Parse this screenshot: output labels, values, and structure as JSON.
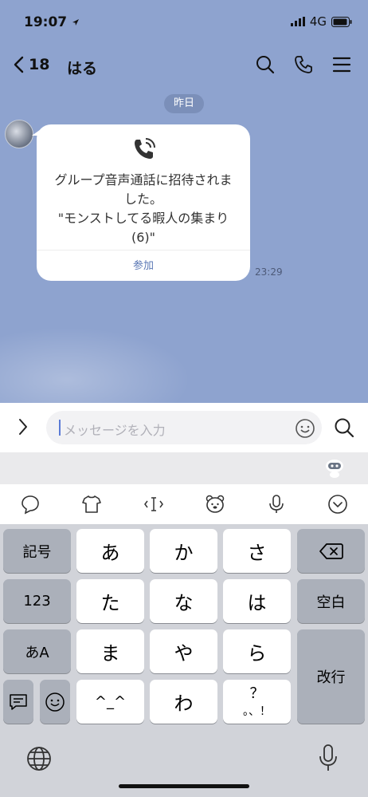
{
  "status": {
    "time": "19:07",
    "network": "4G"
  },
  "header": {
    "back_count": "18",
    "chat_name": "はる"
  },
  "date_label": "昨日",
  "message": {
    "lines": [
      "グループ音声通話に招待されま",
      "した。",
      "\"モンストしてる暇人の集まり",
      "(6)\""
    ],
    "join_label": "参加",
    "time": "23:29"
  },
  "input": {
    "placeholder": "メッセージを入力"
  },
  "keyboard": {
    "row1": [
      "記号",
      "あ",
      "か",
      "さ"
    ],
    "row2": [
      "123",
      "た",
      "な",
      "は",
      "空白"
    ],
    "row3": [
      "あA",
      "ま",
      "や",
      "ら",
      "改行"
    ],
    "row4": [
      "^_^",
      "わ",
      "？",
      "。、！"
    ]
  },
  "colors": {
    "chat_bg": "#8ea3cf",
    "accent": "#5b78b5"
  }
}
